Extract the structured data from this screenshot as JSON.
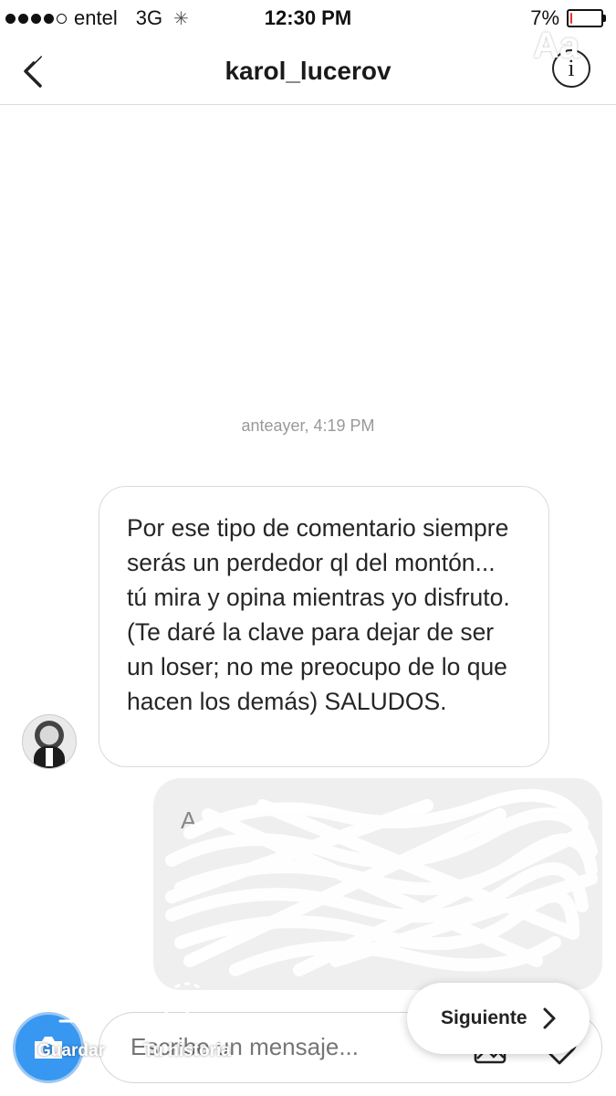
{
  "status_bar": {
    "carrier": "entel",
    "network": "3G",
    "time": "12:30 PM",
    "battery_text": "7%",
    "battery_level": 0.07,
    "battery_color": "#e33333",
    "signal_bars_filled": 4,
    "signal_bars_total": 5
  },
  "header": {
    "title": "karol_lucerov",
    "info_glyph": "i",
    "back_icon": "chevron-left-icon",
    "info_icon": "info-circle-icon"
  },
  "story_overlay": {
    "close_icon": "close-icon",
    "sticker_icon": "sticker-icon",
    "pen_icon": "pen-icon",
    "text_tool_label": "Aa",
    "save_label": "Guardar",
    "story_label": "Tu historia",
    "next_label": "Siguiente"
  },
  "conversation": {
    "timestamp": "anteayer, 4:19 PM",
    "incoming_message": "Por ese tipo de comentario siempre serás un perdedor ql del montón... tú mira y opina mientras yo disfruto. (Te daré la clave para dejar de ser un loser; no me preocupo de lo que hacen los demás) SALUDOS.",
    "outgoing_message_redacted": true
  },
  "composer": {
    "placeholder": "Escribe un mensaje...",
    "accent_color": "#3897f0"
  }
}
